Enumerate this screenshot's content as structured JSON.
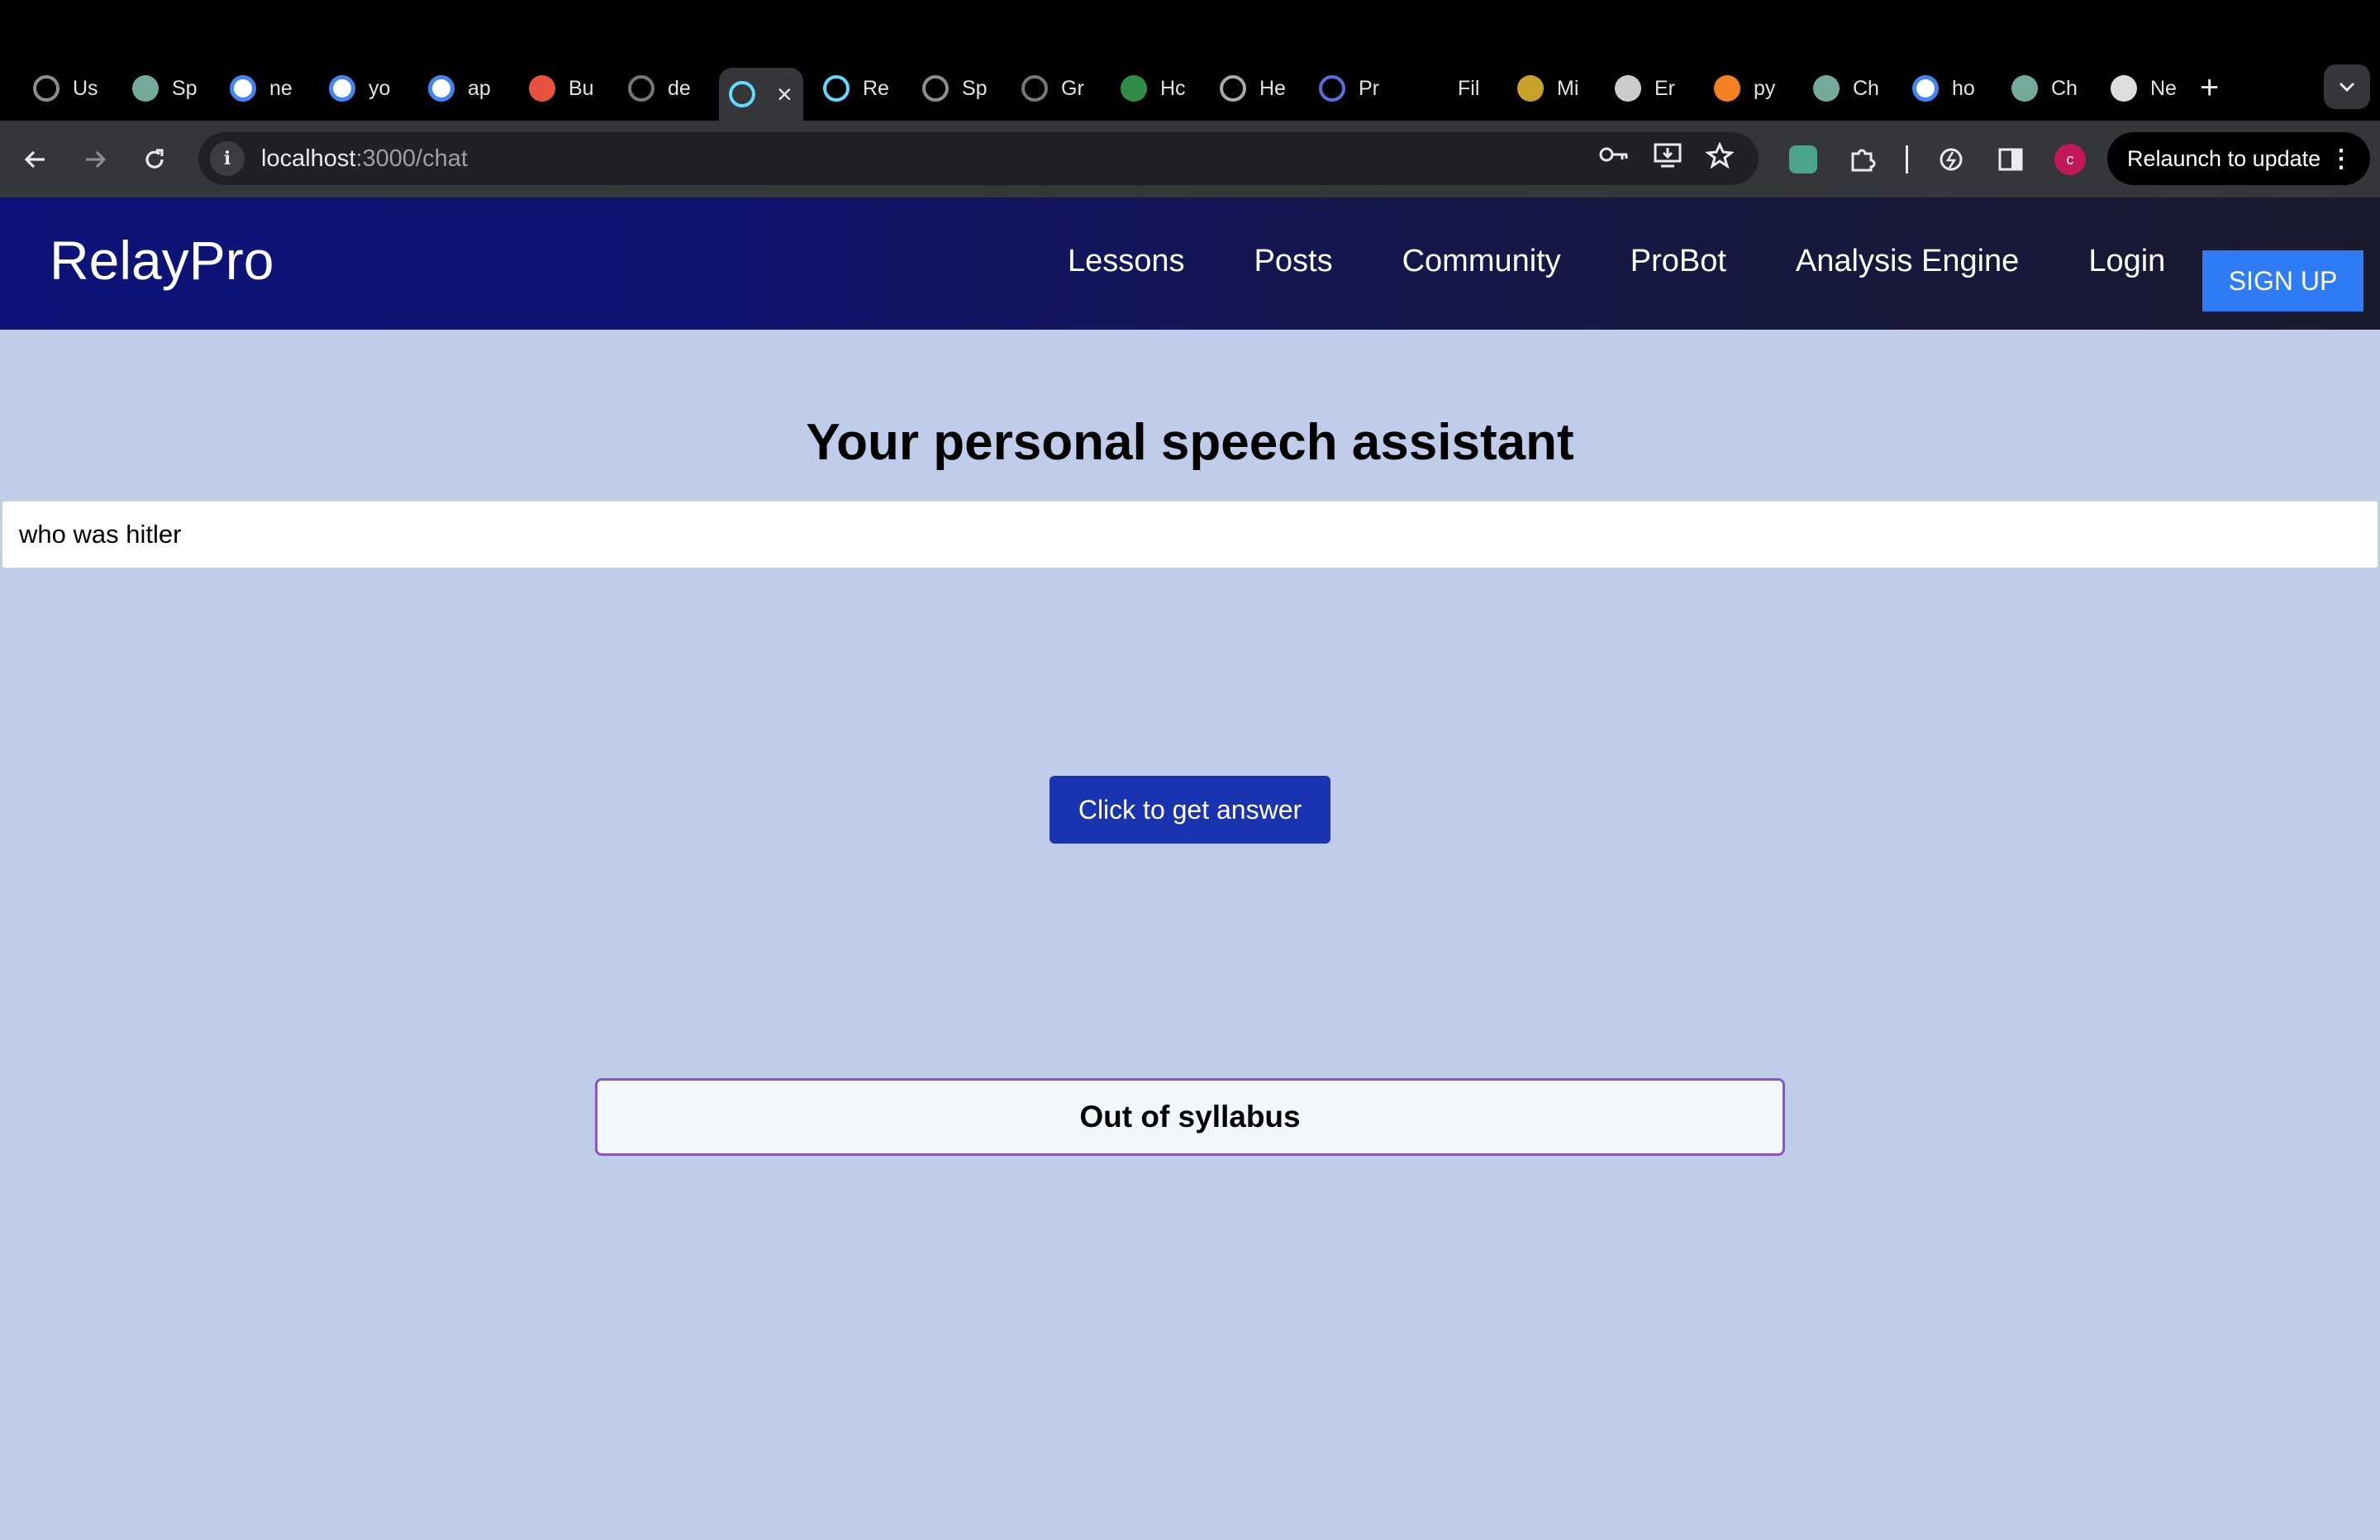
{
  "browser": {
    "tabs": [
      {
        "label": "Us",
        "icon": "openai-icon"
      },
      {
        "label": "Sp",
        "icon": "chatgpt-icon"
      },
      {
        "label": "ne",
        "icon": "google-icon"
      },
      {
        "label": "yo",
        "icon": "google-icon"
      },
      {
        "label": "ap",
        "icon": "google-icon"
      },
      {
        "label": "Bu",
        "icon": "grammarly-icon"
      },
      {
        "label": "de",
        "icon": "github-icon"
      },
      {
        "label": "",
        "icon": "react-icon",
        "active": true
      },
      {
        "label": "Re",
        "icon": "react-icon"
      },
      {
        "label": "Sp",
        "icon": "openai-icon"
      },
      {
        "label": "Gr",
        "icon": "github-icon"
      },
      {
        "label": "Hc",
        "icon": "geeks-icon"
      },
      {
        "label": "He",
        "icon": "loading-icon"
      },
      {
        "label": "Pr",
        "icon": "circle-icon"
      },
      {
        "label": "Fil",
        "icon": "blank-icon"
      },
      {
        "label": "Mi",
        "icon": "mt-icon"
      },
      {
        "label": "Er",
        "icon": "globe-icon"
      },
      {
        "label": "py",
        "icon": "stackoverflow-icon"
      },
      {
        "label": "Ch",
        "icon": "chatgpt-icon"
      },
      {
        "label": "ho",
        "icon": "google-icon"
      },
      {
        "label": "Ch",
        "icon": "chatgpt-icon"
      },
      {
        "label": "Ne",
        "icon": "chrome-icon"
      }
    ],
    "url_host": "localhost",
    "url_path": ":3000/chat",
    "relaunch_label": "Relaunch to update",
    "avatar_letter": "c"
  },
  "app": {
    "brand": "RelayPro",
    "nav": [
      "Lessons",
      "Posts",
      "Community",
      "ProBot",
      "Analysis Engine",
      "Login"
    ],
    "signup_label": "SIGN UP"
  },
  "main": {
    "title": "Your personal speech assistant",
    "question_value": "who was hitler",
    "button_label": "Click to get answer",
    "result": "Out of syllabus"
  },
  "colors": {
    "page_bg": "#bfcdea",
    "header_start": "#0d137a",
    "header_end": "#1a1a2e",
    "signup_bg": "#2f7cf6",
    "answer_btn_bg": "#1a33b0",
    "result_border": "#8a57c0"
  }
}
